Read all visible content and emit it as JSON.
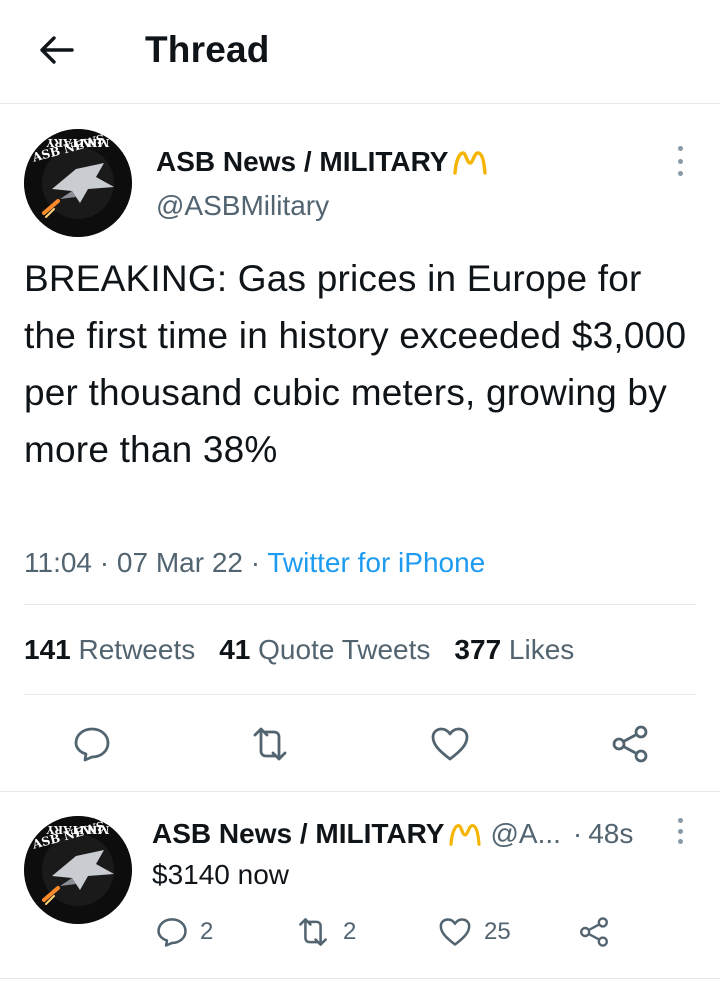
{
  "header": {
    "title": "Thread",
    "back_icon": "arrow-left-icon"
  },
  "main_tweet": {
    "display_name": "ASB News / MILITARY",
    "handle": "@ASBMilitary",
    "badge_color": "#f5b400",
    "avatar_text_top": "ASB NEWS",
    "avatar_text_bottom": "MILITARY",
    "text": "BREAKING: Gas prices in Europe for the first time in history exceeded $3,000 per thousand cubic meters, growing by more than 38%",
    "time": "11:04",
    "date": "07 Mar 22",
    "separator": "·",
    "source": "Twitter for iPhone",
    "stats": [
      {
        "count": "141",
        "label": "Retweets"
      },
      {
        "count": "41",
        "label": "Quote Tweets"
      },
      {
        "count": "377",
        "label": "Likes"
      }
    ]
  },
  "reply_tweet": {
    "display_name": "ASB News / MILITARY",
    "handle": "@A...",
    "separator": "·",
    "time_ago": "48s",
    "text": "$3140 now",
    "reply_count": "2",
    "retweet_count": "2",
    "like_count": "25"
  },
  "colors": {
    "accent": "#1d9bf0",
    "muted": "#536471",
    "icon": "#536471",
    "divider": "#e6e9ec"
  }
}
